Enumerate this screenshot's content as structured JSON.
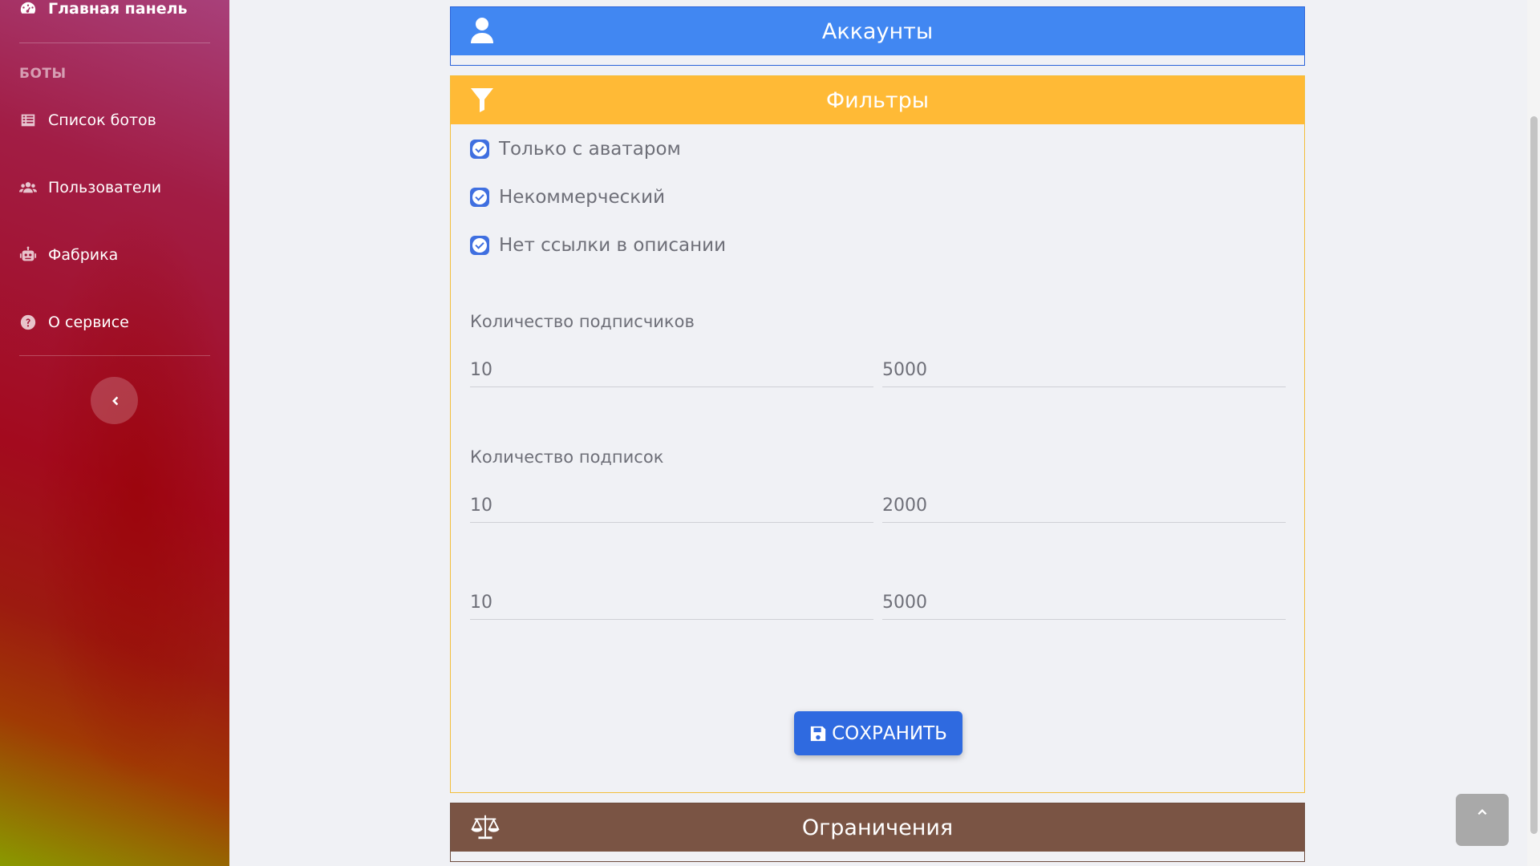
{
  "sidebar": {
    "main_label": "Главная панель",
    "section_heading": "БОТЫ",
    "items": [
      {
        "label": "Список ботов",
        "icon": "list-icon"
      },
      {
        "label": "Пользователи",
        "icon": "users-icon"
      },
      {
        "label": "Фабрика",
        "icon": "robot-icon"
      },
      {
        "label": "О сервисе",
        "icon": "question-icon"
      }
    ],
    "collapse_icon": "chevron-left-icon"
  },
  "cards": {
    "accounts": {
      "title": "Аккаунты",
      "icon": "user-icon",
      "color": "#4187f2"
    },
    "filters": {
      "title": "Фильтры",
      "icon": "filter-icon",
      "color": "#ffba36",
      "checkboxes": [
        {
          "label": "Только с аватаром",
          "checked": true
        },
        {
          "label": "Некоммерческий",
          "checked": true
        },
        {
          "label": "Нет ссылки в описании",
          "checked": true
        }
      ],
      "followers": {
        "label": "Количество подписчиков",
        "min": "10",
        "max": "5000"
      },
      "subscriptions": {
        "label": "Количество подписок",
        "min": "10",
        "max": "2000"
      },
      "third_range": {
        "min": "10",
        "max": "5000"
      },
      "save_label": "СОХРАНИТЬ",
      "save_icon": "save-icon"
    },
    "limits": {
      "title": "Ограничения",
      "icon": "scale-icon",
      "color": "#7a5444"
    }
  },
  "scroll_top_icon": "chevron-up-icon"
}
